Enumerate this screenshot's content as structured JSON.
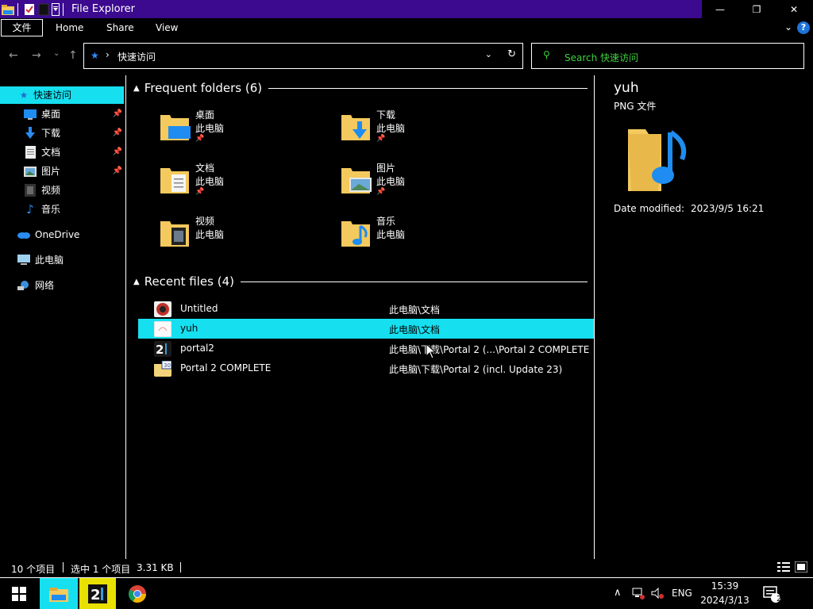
{
  "window": {
    "title": "File Explorer",
    "controls": {
      "minimize": "—",
      "maximize": "❐",
      "close": "✕"
    }
  },
  "ribbon": {
    "tabs": [
      "文件",
      "Home",
      "Share",
      "View"
    ],
    "help": "?"
  },
  "address": {
    "path": "快速访问",
    "search_placeholder": "Search 快速访问"
  },
  "nav": {
    "quick_access": "快速访问",
    "items": [
      {
        "label": "桌面",
        "icon": "desktop-icon",
        "pinned": true
      },
      {
        "label": "下载",
        "icon": "download-icon",
        "pinned": true
      },
      {
        "label": "文档",
        "icon": "document-icon",
        "pinned": true
      },
      {
        "label": "图片",
        "icon": "picture-icon",
        "pinned": true
      },
      {
        "label": "视频",
        "icon": "video-icon",
        "pinned": false
      },
      {
        "label": "音乐",
        "icon": "music-icon",
        "pinned": false
      }
    ],
    "onedrive": "OneDrive",
    "this_pc": "此电脑",
    "network": "网络"
  },
  "frequent": {
    "header": "Frequent folders (6)",
    "folders": [
      {
        "name": "桌面",
        "location": "此电脑",
        "pinned": true,
        "icon": "desktop-folder-icon"
      },
      {
        "name": "下载",
        "location": "此电脑",
        "pinned": true,
        "icon": "download-folder-icon"
      },
      {
        "name": "文档",
        "location": "此电脑",
        "pinned": true,
        "icon": "document-folder-icon"
      },
      {
        "name": "图片",
        "location": "此电脑",
        "pinned": true,
        "icon": "picture-folder-icon"
      },
      {
        "name": "视频",
        "location": "此电脑",
        "pinned": false,
        "icon": "video-folder-icon"
      },
      {
        "name": "音乐",
        "location": "此电脑",
        "pinned": false,
        "icon": "music-folder-icon"
      }
    ]
  },
  "recent": {
    "header": "Recent files (4)",
    "files": [
      {
        "name": "Untitled",
        "path": "此电脑\\文档",
        "selected": false,
        "icon": "image-file-icon"
      },
      {
        "name": "yuh",
        "path": "此电脑\\文档",
        "selected": true,
        "icon": "png-file-icon"
      },
      {
        "name": "portal2",
        "path": "此电脑\\下载\\Portal 2 (...\\Portal 2 COMPLETE",
        "selected": false,
        "icon": "portal2-icon"
      },
      {
        "name": "Portal 2 COMPLETE",
        "path": "此电脑\\下载\\Portal 2 (incl. Update 23)",
        "selected": false,
        "icon": "shortcut-folder-icon"
      }
    ]
  },
  "preview": {
    "title": "yuh",
    "type": "PNG 文件",
    "date_label": "Date modified:",
    "date_value": "2023/9/5 16:21"
  },
  "status": {
    "item_count": "10 个项目",
    "selection": "选中 1 个项目",
    "size": "3.31 KB"
  },
  "taskbar": {
    "time": "15:39",
    "date": "2024/3/13",
    "lang": "ENG",
    "notifications": "2"
  },
  "colors": {
    "titlebar": "#3b0a8f",
    "selection": "#16e0f0",
    "search_text": "#3fd13f",
    "folder_yellow": "#f4c95d",
    "accent_blue": "#1e8cf0"
  }
}
